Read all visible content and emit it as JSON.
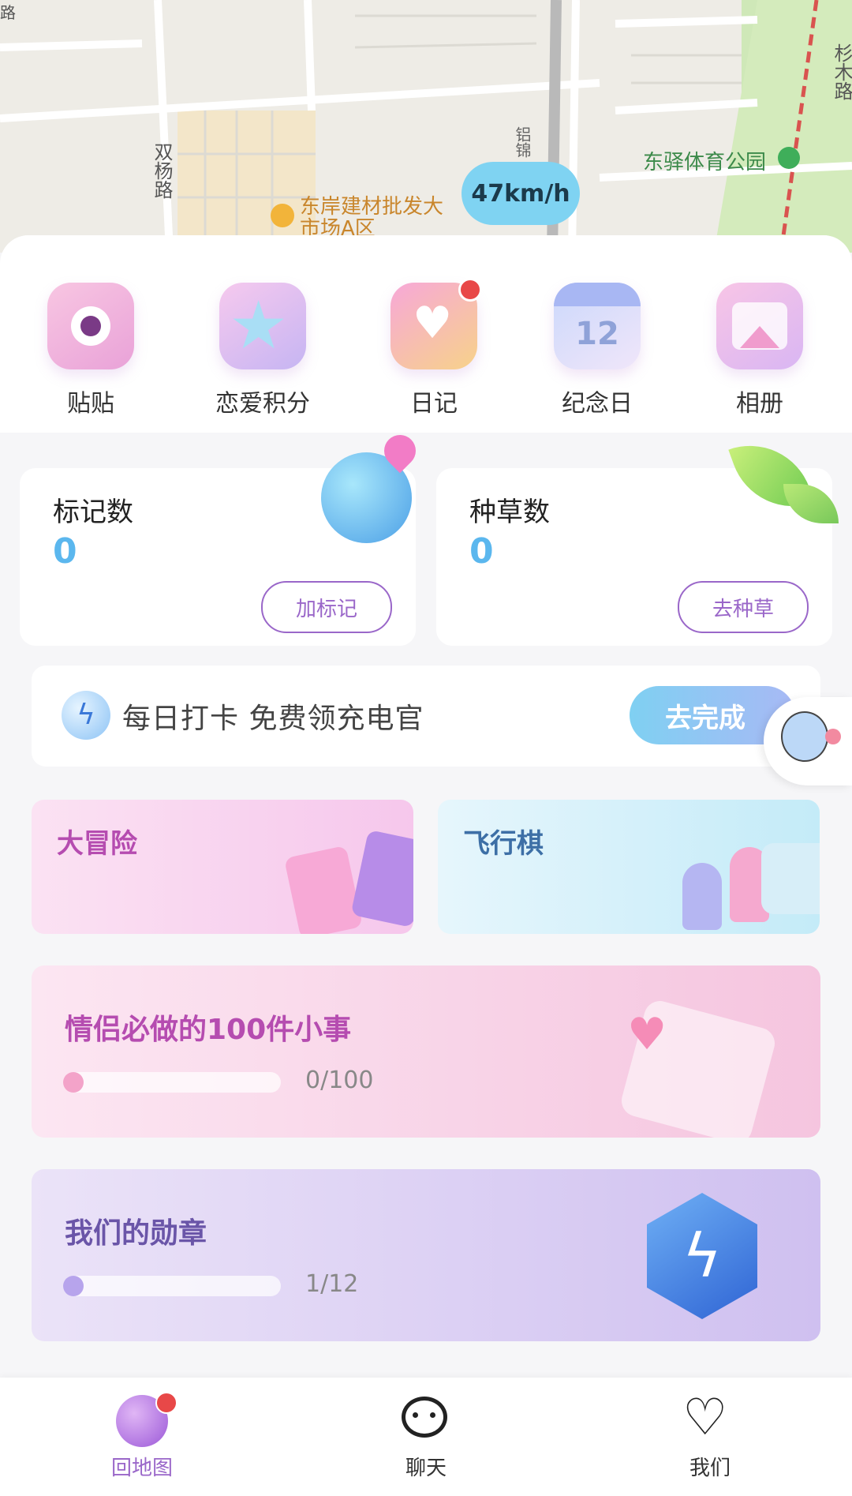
{
  "map": {
    "speed": "47km/h",
    "road_labels": [
      "双杨路",
      "杉木路",
      "铝锦",
      "路"
    ],
    "park_label": "东驿体育公园",
    "poi_label": "东岸建材批发大市场A区"
  },
  "quick_actions": [
    {
      "label": "贴贴",
      "icon": "camera-icon",
      "badge": false
    },
    {
      "label": "恋爱积分",
      "icon": "star-icon",
      "badge": false
    },
    {
      "label": "日记",
      "icon": "diary-icon",
      "badge": true
    },
    {
      "label": "纪念日",
      "icon": "calendar-icon",
      "badge": false,
      "icon_text": "12"
    },
    {
      "label": "相册",
      "icon": "album-icon",
      "badge": false
    }
  ],
  "stats": [
    {
      "title": "标记数",
      "value": "0",
      "button": "加标记",
      "icon": "globe-pin-icon"
    },
    {
      "title": "种草数",
      "value": "0",
      "button": "去种草",
      "icon": "leaf-icon"
    }
  ],
  "daily": {
    "text": "每日打卡 免费领充电官",
    "button": "去完成"
  },
  "games": [
    {
      "title": "大冒险",
      "color": "#b54cb0"
    },
    {
      "title": "飞行棋",
      "color": "#3d6fa6"
    }
  ],
  "tasks": [
    {
      "title": "情侣必做的100件小事",
      "progress_text": "0/100",
      "progress": 0.0,
      "color": "#b54cb0"
    },
    {
      "title": "我们的勋章",
      "progress_text": "1/12",
      "progress": 0.083,
      "color": "#6a55a8"
    }
  ],
  "tabs": [
    {
      "label": "回地图",
      "active": true,
      "badge": true
    },
    {
      "label": "聊天",
      "active": false,
      "badge": false
    },
    {
      "label": "我们",
      "active": false,
      "badge": false
    }
  ],
  "colors": {
    "accent": "#9a67c9",
    "value_blue": "#5bb7ee",
    "badge_red": "#e84848"
  }
}
